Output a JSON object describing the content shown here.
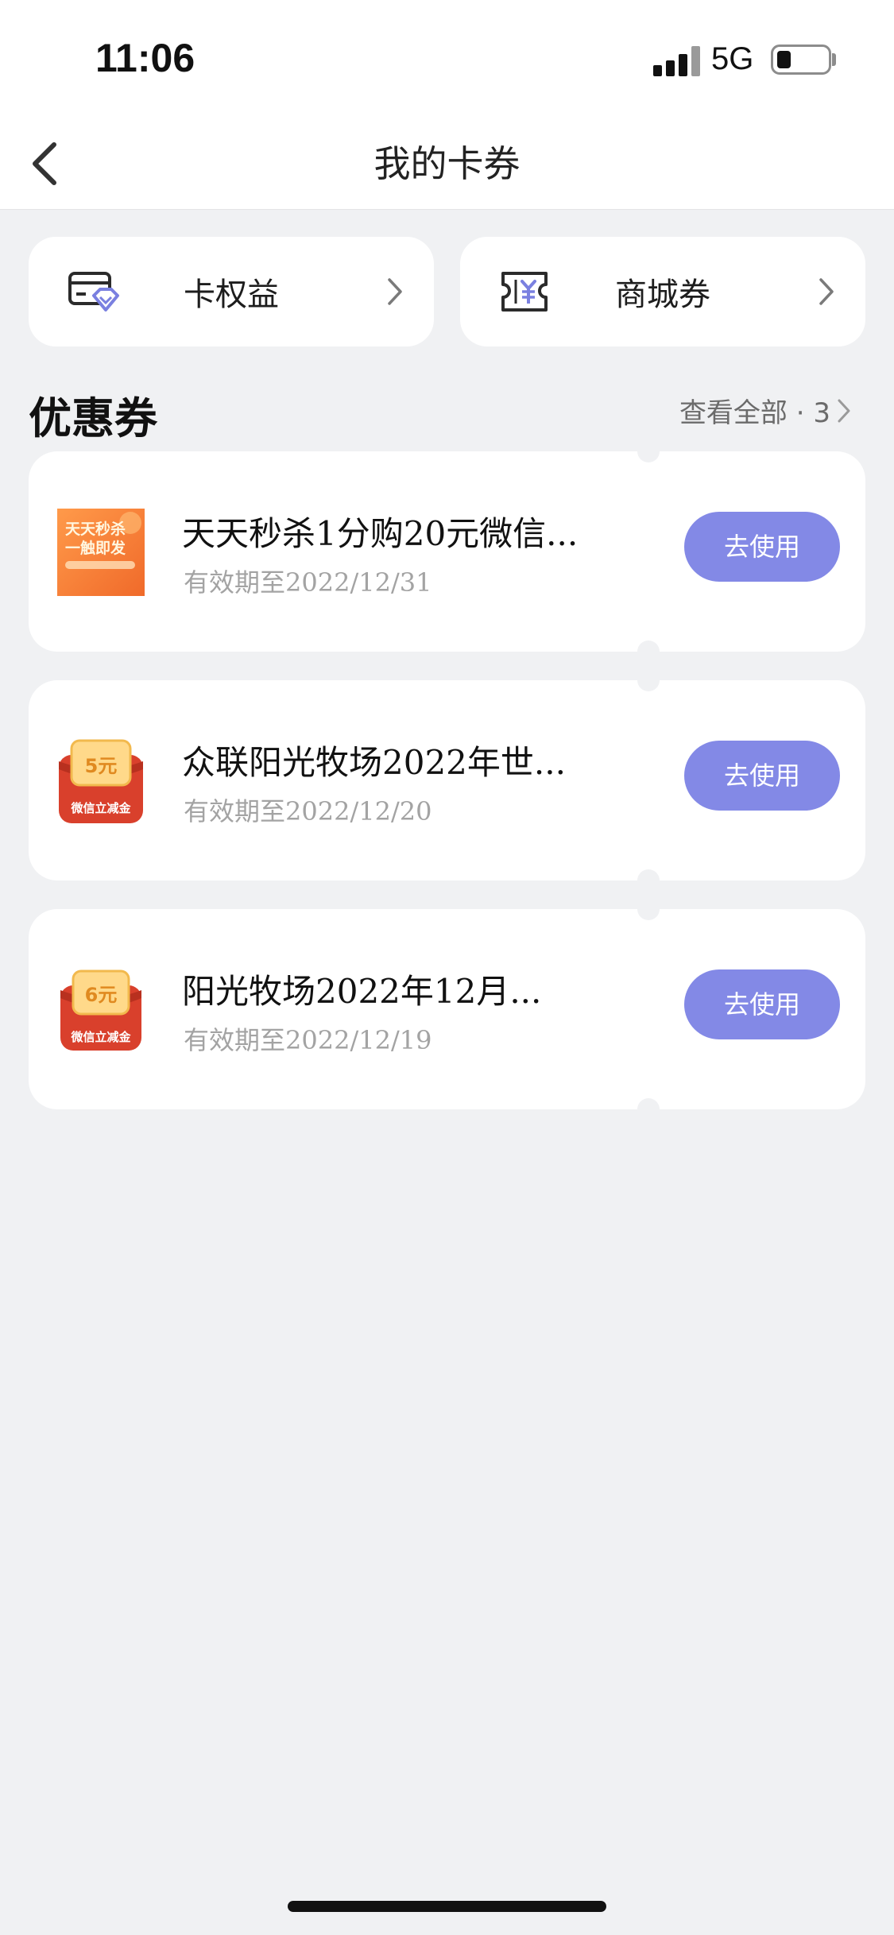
{
  "status_bar": {
    "time": "11:06",
    "network": "5G"
  },
  "header": {
    "title": "我的卡券"
  },
  "entries": [
    {
      "label": "卡权益",
      "icon": "card-benefit-icon"
    },
    {
      "label": "商城券",
      "icon": "mall-coupon-icon"
    }
  ],
  "section": {
    "title": "优惠券",
    "view_all": "查看全部 · 3"
  },
  "coupons": [
    {
      "title": "天天秒杀1分购20元微信...",
      "expire": "有效期至2022/12/31",
      "button": "去使用",
      "thumb": {
        "line1": "天天秒杀",
        "line2": "一触即发"
      }
    },
    {
      "title": "众联阳光牧场2022年世...",
      "expire": "有效期至2022/12/20",
      "button": "去使用",
      "thumb": {
        "amount": "5元",
        "caption": "微信立减金"
      }
    },
    {
      "title": "阳光牧场2022年12月...",
      "expire": "有效期至2022/12/19",
      "button": "去使用",
      "thumb": {
        "amount": "6元",
        "caption": "微信立减金"
      }
    }
  ],
  "colors": {
    "accent": "#8389e6",
    "background": "#f0f1f3"
  }
}
